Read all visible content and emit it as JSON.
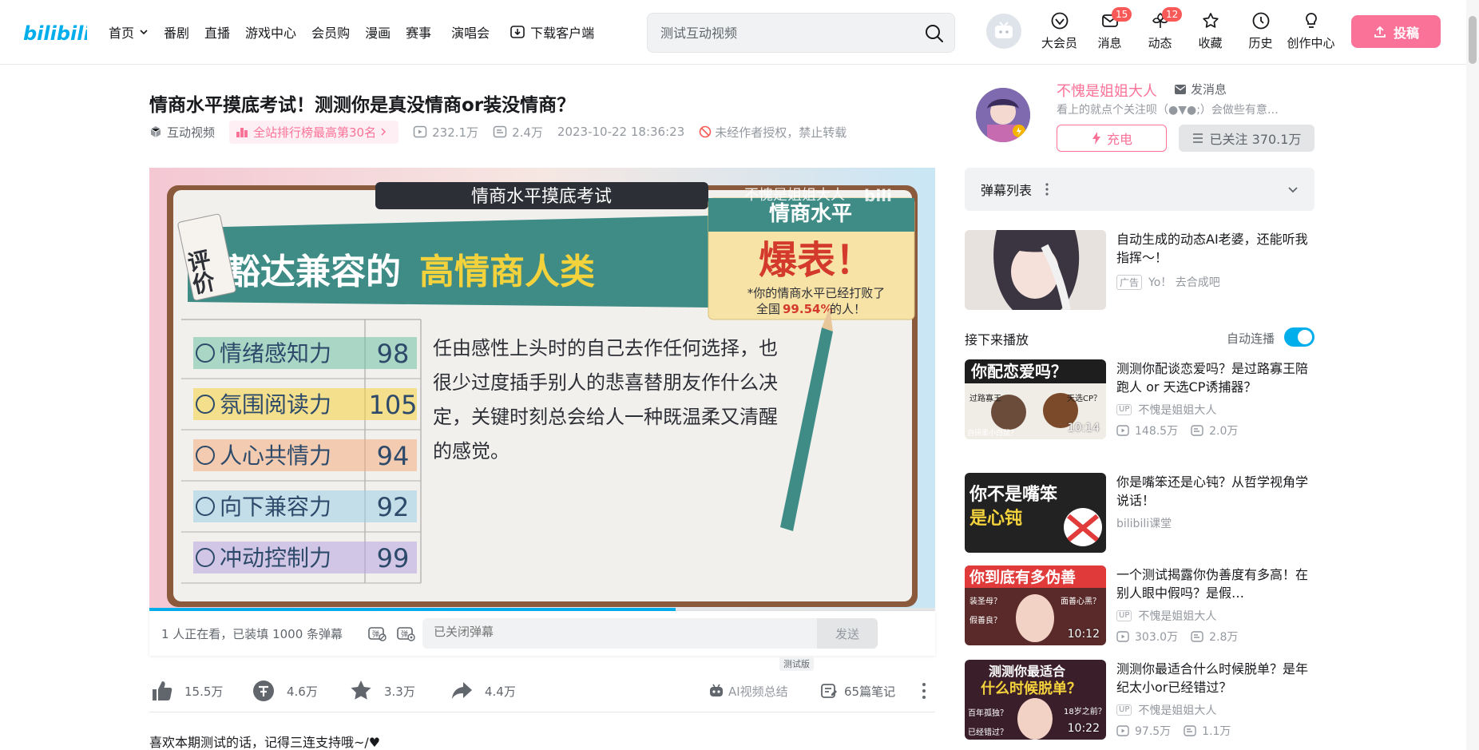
{
  "header": {
    "logo_text": "bilibili",
    "nav": [
      {
        "label": "首页"
      },
      {
        "label": "番剧"
      },
      {
        "label": "直播"
      },
      {
        "label": "游戏中心"
      },
      {
        "label": "会员购"
      },
      {
        "label": "漫画"
      },
      {
        "label": "赛事"
      },
      {
        "label": "演唱会"
      },
      {
        "label": "下载客户端"
      }
    ],
    "search_placeholder": "测试互动视频",
    "icons": [
      {
        "label": "大会员",
        "icon": "vip-icon"
      },
      {
        "label": "消息",
        "icon": "message-icon",
        "badge": "15"
      },
      {
        "label": "动态",
        "icon": "dynamic-icon",
        "badge": "12"
      },
      {
        "label": "收藏",
        "icon": "favorite-icon"
      },
      {
        "label": "历史",
        "icon": "history-icon"
      },
      {
        "label": "创作中心",
        "icon": "creator-icon"
      }
    ],
    "upload_label": "投稿"
  },
  "video": {
    "title": "情商水平摸底考试！测测你是真没情商or装没情商？",
    "type": "互动视频",
    "rank": "全站排行榜最高第30名",
    "views": "232.1万",
    "danmaku": "2.4万",
    "date": "2023-10-22 18:36:23",
    "copyright": "未经作者授权，禁止转载",
    "progress_fraction": 0.67
  },
  "frame": {
    "header": "情商水平摸底考试",
    "eval_tag": "评价",
    "headline_plain": "豁达兼容的",
    "headline_highlight": "高情商人类",
    "watermark": "不愧是姐姐大人",
    "watermark_logo": "bili",
    "eq_label": "情商水平",
    "eq_big": "爆表！",
    "eq_sub1": "*你的情商水平已经打败了",
    "eq_sub2_prefix": "全国",
    "eq_sub2_pct": "99.54%",
    "eq_sub2_suffix": "的人！",
    "scores": [
      {
        "label": "情绪感知力",
        "value": "98",
        "color": "#6fc3a4",
        "icon": "bulb-icon"
      },
      {
        "label": "氛围阅读力",
        "value": "105",
        "color": "#f4d23c",
        "icon": "document-icon"
      },
      {
        "label": "人心共情力",
        "value": "94",
        "color": "#f3ad80",
        "icon": "heart-icon"
      },
      {
        "label": "向下兼容力",
        "value": "92",
        "color": "#9fd0e6",
        "icon": "arrow-circle-icon"
      },
      {
        "label": "冲动控制力",
        "value": "99",
        "color": "#b8a4e0",
        "icon": "fist-icon"
      }
    ],
    "paragraph": "任由感性上头时的自己去作任何选择，也很少过度插手别人的悲喜替朋友作什么决定，关键时刻总会给人一种既温柔又清醒的感觉。"
  },
  "danmaku_bar": {
    "info": "1 人正在看，已装填 1000 条弹幕",
    "placeholder": "已关闭弹幕",
    "send": "发送"
  },
  "actions": {
    "like": "15.5万",
    "coin": "4.6万",
    "fav": "3.3万",
    "share": "4.4万",
    "ai_summary": "AI视频总结",
    "beta": "测试版",
    "notes": "65篇笔记"
  },
  "description": "喜欢本期测试的话，记得三连支持哦~/♥",
  "uploader": {
    "name": "不愧是姐姐大人",
    "send_msg": "发消息",
    "desc": "看上的就点个关注呗（●▼●;）会做些有意…",
    "charge": "充电",
    "follow": "已关注 370.1万"
  },
  "danmu_list": {
    "title": "弹幕列表"
  },
  "ad": {
    "title": "自动生成的动态AI老婆，还能听我指挥～！",
    "tag": "广告",
    "sub": "Yo！ 去合成吧"
  },
  "next": {
    "title": "接下来播放",
    "autoplay": "自动连播",
    "autoplay_on": true
  },
  "recommendations": [
    {
      "title": "测测你配谈恋爱吗？是过路寡王陪跑人 or 天选CP诱捕器？",
      "up": "不愧是姐姐大人",
      "up_tag": "UP",
      "views": "148.5万",
      "danmaku": "2.0万",
      "duration": "10:14",
      "thumb_text": "你配恋爱吗？",
      "thumb_side1": "过路寡王",
      "thumb_side2": "天选CP？",
      "thumb_bottom": "自研黑小白鼠？"
    },
    {
      "title": "你是嘴笨还是心钝？从哲学视角学说话！",
      "up": "bilibili课堂",
      "up_tag": "",
      "views": "",
      "danmaku": "",
      "duration": "",
      "thumb_text": "你不是嘴笨",
      "thumb_line2": "是心钝"
    },
    {
      "title": "一个测试揭露你伪善度有多高！在别人眼中假吗？是假…",
      "up": "不愧是姐姐大人",
      "up_tag": "UP",
      "views": "303.0万",
      "danmaku": "2.8万",
      "duration": "10:12",
      "thumb_text": "你到底有多伪善",
      "thumb_side1": "装圣母？",
      "thumb_side2": "面善心黑？",
      "thumb_bottom": "假善良？"
    },
    {
      "title": "测测你最适合什么时候脱单？是年纪太小or已经错过？",
      "up": "不愧是姐姐大人",
      "up_tag": "UP",
      "views": "97.5万",
      "danmaku": "1.1万",
      "duration": "10:22",
      "thumb_text": "测测你最适合",
      "thumb_line2": "什么时候脱单？",
      "thumb_side1": "百年孤独？",
      "thumb_side2": "18岁之前？",
      "thumb_bottom": "已经错过？"
    }
  ],
  "colors": {
    "brand_pink": "#fb7299",
    "brand_blue": "#00aeec",
    "text_primary": "#18191c",
    "text_secondary": "#61666d",
    "text_muted": "#9499a0"
  }
}
